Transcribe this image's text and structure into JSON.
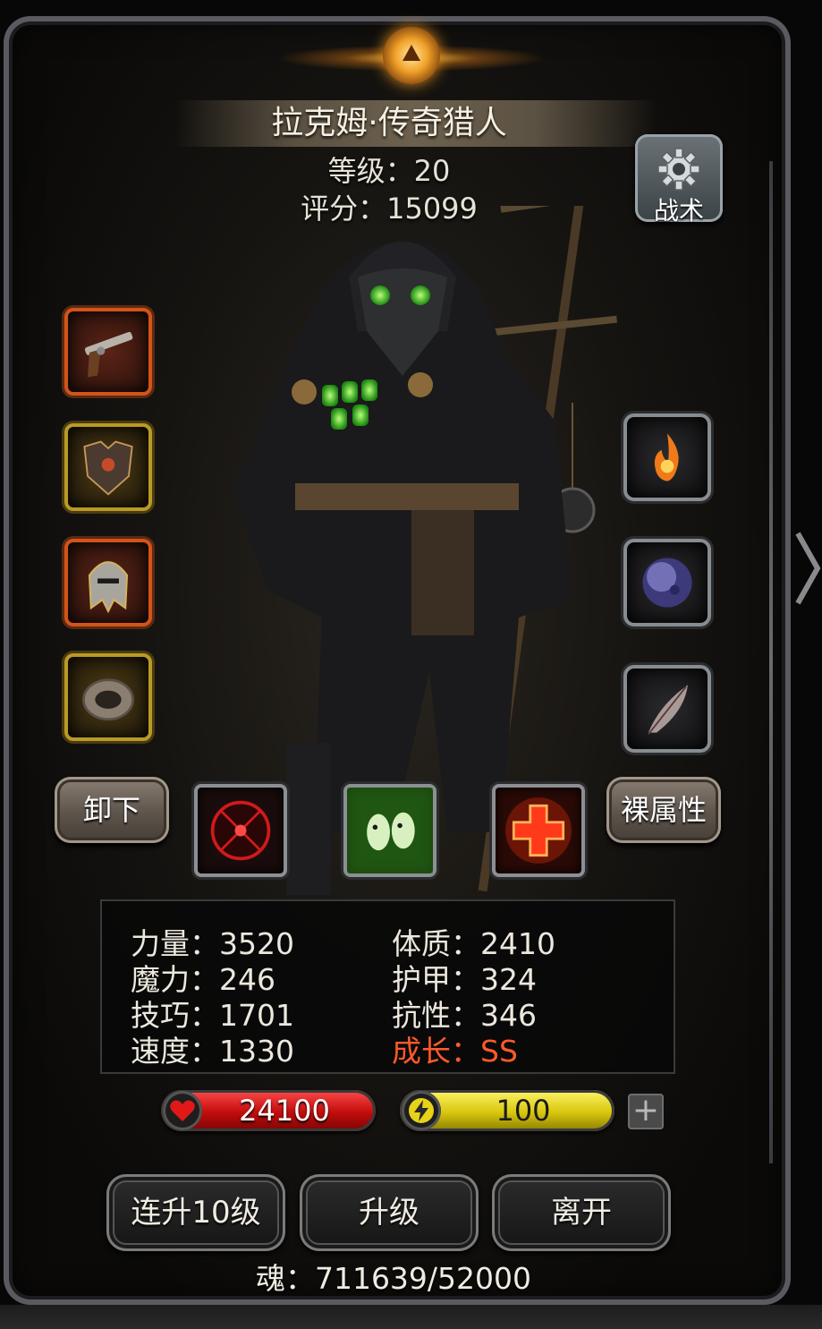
{
  "hero": {
    "name": "拉克姆·传奇猎人",
    "level_text": "等级：20",
    "score_text": "评分：15099"
  },
  "buttons": {
    "tactics": "战术",
    "unequip": "卸下",
    "base_attributes": "裸属性",
    "level_up_10": "连升10级",
    "level_up": "升级",
    "leave": "离开"
  },
  "equipment_left": [
    {
      "icon": "pistol-icon",
      "rarity": "orange"
    },
    {
      "icon": "armor-icon",
      "rarity": "gold"
    },
    {
      "icon": "helmet-icon",
      "rarity": "orange"
    },
    {
      "icon": "ring-icon",
      "rarity": "gold"
    }
  ],
  "equipment_right": [
    {
      "icon": "fire-rune-icon"
    },
    {
      "icon": "moon-orb-icon"
    },
    {
      "icon": "feather-icon"
    }
  ],
  "skills": [
    {
      "icon": "crosshair-skill-icon"
    },
    {
      "icon": "ghost-skill-icon"
    },
    {
      "icon": "heal-cross-skill-icon"
    }
  ],
  "stats": {
    "strength": "力量：3520",
    "constitution": "体质：2410",
    "magic": "魔力：246",
    "armor": "护甲：324",
    "skill": "技巧：1701",
    "resistance": "抗性：346",
    "speed": "速度：1330",
    "growth": "成长：SS"
  },
  "bars": {
    "hp": "24100",
    "energy": "100"
  },
  "soul_text": "魂：711639/52000",
  "colors": {
    "growth": "#ff5a2a",
    "hp_bar": "#c10c0c",
    "energy_bar": "#d8c60c"
  }
}
